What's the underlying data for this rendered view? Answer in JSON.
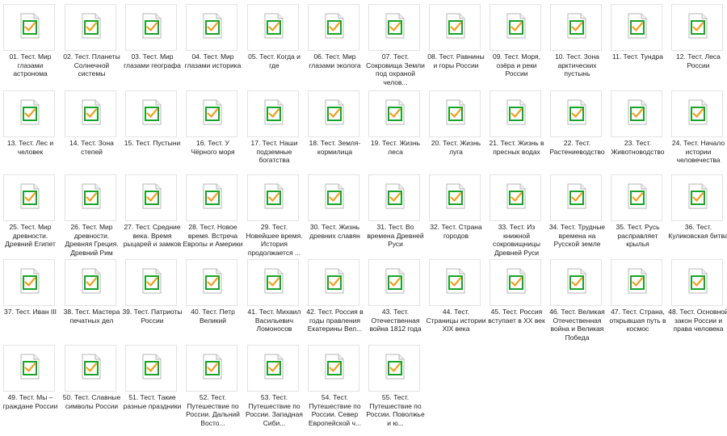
{
  "colors": {
    "check": "#1aa32a",
    "check_orange": "#f0a020",
    "icon_border": "#b7b7b7",
    "thumb_border": "#e3e3e3"
  },
  "icon": "document-check-icon",
  "files": [
    "01. Тест. Мир глазами астронома",
    "02. Тест. Планеты Солнечной системы",
    "03. Тест. Мир глазами географа",
    "04. Тест. Мир глазами историка",
    "05. Тест. Когда и где",
    "06. Тест. Мир глазами эколога",
    "07. Тест. Сокровища Земли под охраной челов...",
    "08. Тест. Равнины и горы России",
    "09. Тест. Моря, озёра и реки России",
    "10. Тест. Зона арктических пустынь",
    "11. Тест. Тундра",
    "12. Тест. Леса России",
    "13. Тест. Лес и человек",
    "14. Тест. Зона степей",
    "15. Тест. Пустыни",
    "16. Тест. У Чёрного моря",
    "17. Тест. Наши подземные богатства",
    "18. Тест. Земля-кормилица",
    "19. Тест. Жизнь леса",
    "20. Тест. Жизнь луга",
    "21. Тест. Жизнь в пресных водах",
    "22. Тест. Растениеводство",
    "23. Тест. Животноводство",
    "24. Тест. Начало истории человечества",
    "25. Тест. Мир древности. Древний Египет",
    "26. Тест. Мир древности. Древняя Греция. Древний Рим",
    "27. Тест. Средние века. Время рыцарей и замков",
    "28. Тест. Новое время. Встреча Европы и Америки",
    "29. Тест. Новейшее время. История продолжается ...",
    "30. Тест. Жизнь древних славян",
    "31. Тест. Во времена Древней Руси",
    "32. Тест. Страна городов",
    "33. Тест. Из книжной сокровищницы Древней Руси",
    "34. Тест. Трудные времена на Русской земле",
    "35. Тест. Русь расправляет крылья",
    "36. Тест. Куликовская битва",
    "37. Тест. Иван III",
    "38. Тест. Мастера печатных дел",
    "39. Тест. Патриоты России",
    "40. Тест. Петр Великий",
    "41. Тест. Михаил Васильевич Ломоносов",
    "42. Тест. Россия в годы правления Екатерины Вел...",
    "43. Тест. Отечественная война 1812 года",
    "44. Тест. Страницы истории XIX века",
    "45. Тест. Россия вступает в XX век",
    "46. Тест. Великая Отечественная война и Великая Победа",
    "47. Тест. Страна, открывшая путь в космос",
    "48. Тест. Основной закон России и права человека",
    "49. Тест. Мы – граждане России",
    "50. Тест. Славные символы России",
    "51. Тест. Такие разные праздники",
    "52. Тест. Путешествие по России. Дальний Восто...",
    "53. Тест. Путешествие по России. Западная Сиби...",
    "54. Тест. Путешествие по России. Север Европейской ч...",
    "55. Тест. Путешествие по России. Поволжье и ю..."
  ]
}
